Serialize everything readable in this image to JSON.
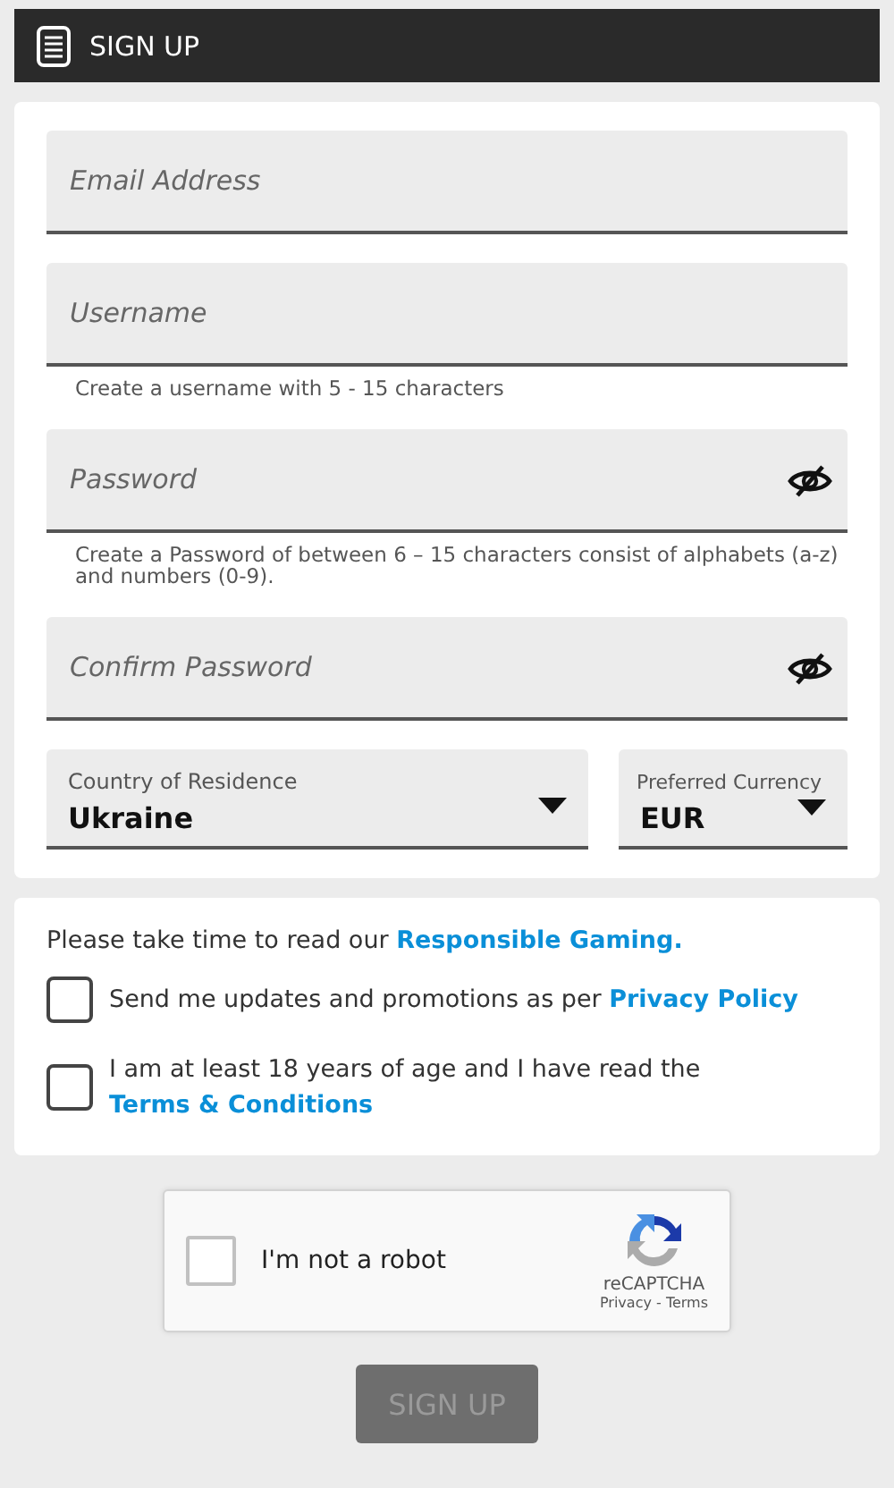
{
  "header": {
    "title": "SIGN UP"
  },
  "fields": [
    {
      "kind": "text",
      "placeholder": "Email Address"
    },
    {
      "kind": "text",
      "placeholder": "Username",
      "hint": "Create a username with 5 - 15 characters"
    },
    {
      "kind": "password",
      "placeholder": "Password",
      "hint": "Create a Password of between 6 – 15 characters consist of alphabets (a-z) and numbers (0-9)."
    },
    {
      "kind": "password",
      "placeholder": "Confirm Password"
    }
  ],
  "selects": [
    {
      "label": "Country of Residence",
      "value": "Ukraine"
    },
    {
      "label": "Preferred Currency",
      "value": "EUR"
    }
  ],
  "notice": {
    "text": "Please take time to read our ",
    "link": "Responsible Gaming."
  },
  "agreements": [
    {
      "text": "Send me updates and promotions as per ",
      "link": "Privacy Policy",
      "checked": false
    },
    {
      "text": "I am at least 18 years of age and I have read the ",
      "link": "Terms & Conditions",
      "checked": false
    }
  ],
  "captcha": {
    "label": "I'm not a robot",
    "checked": false,
    "brand": "reCAPTCHA",
    "privacy": "Privacy",
    "separator": " - ",
    "terms": "Terms"
  },
  "submit": {
    "label": "SIGN UP",
    "disabled": true
  }
}
